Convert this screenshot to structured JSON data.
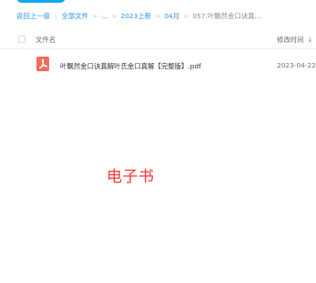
{
  "breadcrumb": {
    "back": "返回上一级",
    "items": [
      "全部文件",
      "...",
      "2023上新",
      "04月"
    ],
    "current": "057.叶飘然金口诀真...",
    "separator": ">",
    "divider": "|"
  },
  "file_list": {
    "header": {
      "name_label": "文件名",
      "time_label": "修改时间",
      "sort_icon": "sort-down-arrow"
    },
    "rows": [
      {
        "icon": "pdf-file-icon",
        "name": "叶飘然金口诀真解叶氏金口真解【完整版】.pdf",
        "modified": "2023-04-22"
      }
    ]
  },
  "overlay_text": "电子书",
  "colors": {
    "accent": "#2b93ef",
    "button": "#11a5f2",
    "pdf_icon": "#f26b5b",
    "overlay": "#ff3333"
  }
}
